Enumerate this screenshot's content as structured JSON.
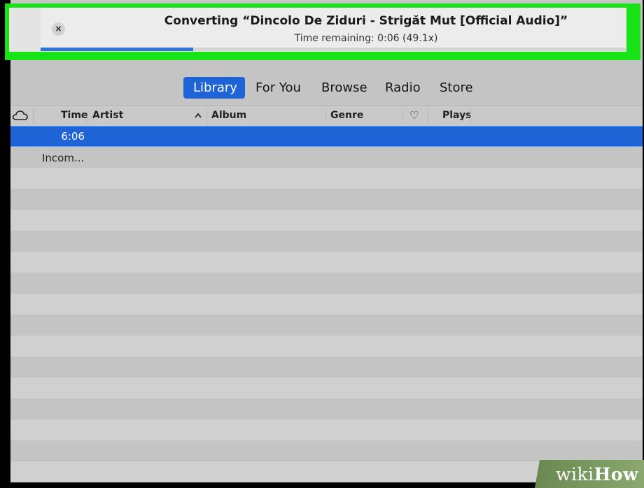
{
  "conversion": {
    "close_label": "×",
    "title": "Converting “Dincolo De Ziduri - Strigăt Mut [Official Audio]”",
    "subtitle": "Time remaining: 0:06 (49.1x)",
    "progress_fraction": 0.26
  },
  "nav": {
    "tabs": [
      {
        "label": "Library",
        "active": true
      },
      {
        "label": "For You",
        "active": false
      },
      {
        "label": "Browse",
        "active": false
      },
      {
        "label": "Radio",
        "active": false
      },
      {
        "label": "Store",
        "active": false
      }
    ]
  },
  "table": {
    "columns": {
      "time": "Time",
      "artist": "Artist",
      "album": "Album",
      "genre": "Genre",
      "plays": "Plays"
    },
    "sort_indicator": "^",
    "heart_glyph": "♡",
    "rows": [
      {
        "time": "6:06",
        "selected": true
      },
      {
        "status": "Incom..."
      }
    ]
  },
  "watermark": {
    "wiki": "wiki",
    "how": "How"
  },
  "colors": {
    "highlight": "#17e317",
    "accent": "#1f64d6",
    "progress": "#2f73d3"
  },
  "icons": [
    "close-icon",
    "cloud-icon",
    "sort-up-icon",
    "heart-icon"
  ]
}
